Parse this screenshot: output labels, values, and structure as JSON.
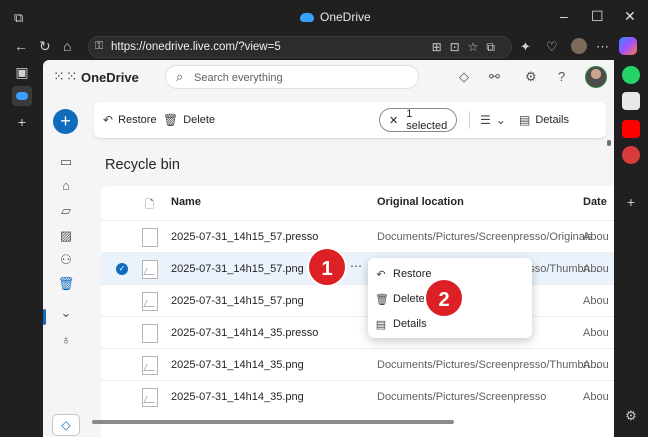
{
  "browser": {
    "window_title": "OneDrive",
    "url": "https://onedrive.live.com/?view=5"
  },
  "header": {
    "app_name": "OneDrive",
    "search_placeholder": "Search everything"
  },
  "command_bar": {
    "restore_label": "Restore",
    "delete_label": "Delete",
    "selection_label": "1 selected",
    "details_label": "Details"
  },
  "page_title": "Recycle bin",
  "table": {
    "columns": [
      "Name",
      "Original location",
      "Date"
    ],
    "rows": [
      {
        "name": "2025-07-31_14h15_57.presso",
        "location": "Documents/Pictures/Screenpresso/Originals",
        "date": "Abou",
        "type": "file",
        "selected": false
      },
      {
        "name": "2025-07-31_14h15_57.png",
        "location": "Documents/Pictures/Screenpresso/Thumbn...",
        "date": "Abou",
        "type": "image",
        "selected": true
      },
      {
        "name": "2025-07-31_14h15_57.png",
        "location": "",
        "date": "Abou",
        "type": "image",
        "selected": false
      },
      {
        "name": "2025-07-31_14h14_35.presso",
        "location": "",
        "date": "Abou",
        "type": "file",
        "selected": false
      },
      {
        "name": "2025-07-31_14h14_35.png",
        "location": "Documents/Pictures/Screenpresso/Thumbn...",
        "date": "Abou",
        "type": "image",
        "selected": false
      },
      {
        "name": "2025-07-31_14h14_35.png",
        "location": "Documents/Pictures/Screenpresso",
        "date": "Abou",
        "type": "image",
        "selected": false
      }
    ]
  },
  "context_menu": {
    "items": [
      "Restore",
      "Delete",
      "Details"
    ]
  },
  "annotations": {
    "badge_1": "1",
    "badge_2": "2"
  },
  "colors": {
    "accent": "#0f6cbd",
    "badge": "#dd1f26",
    "selected_row": "#eaf2fb"
  }
}
